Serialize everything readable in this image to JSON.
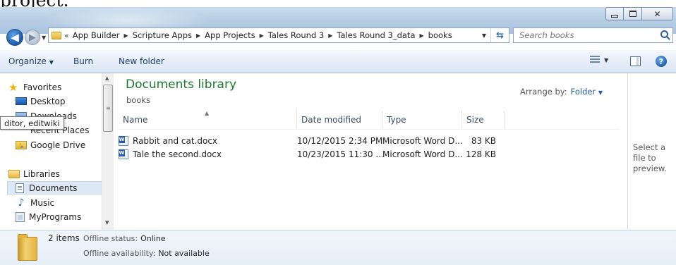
{
  "overlay_text": "project.",
  "window": {
    "minimize": "minimize",
    "maximize": "maximize",
    "close_glyph": "✕"
  },
  "address_bar": {
    "overflow_chevron": "«",
    "crumbs": [
      "App Builder",
      "Scripture Apps",
      "App Projects",
      "Tales Round 3",
      "Tales Round 3_data",
      "books"
    ]
  },
  "search": {
    "placeholder": "Search books"
  },
  "toolbar": {
    "organize": "Organize",
    "burn": "Burn",
    "new_folder": "New folder"
  },
  "nav": {
    "favorites": "Favorites",
    "desktop": "Desktop",
    "downloads": "Downloads",
    "recent_places": "Recent Places",
    "google_drive": "Google Drive",
    "libraries": "Libraries",
    "documents": "Documents",
    "music": "Music",
    "myprograms": "MyPrograms"
  },
  "tooltip": "ditor, editwiki",
  "library": {
    "title": "Documents library",
    "subtitle": "books",
    "arrange_label": "Arrange by:",
    "arrange_value": "Folder"
  },
  "columns": {
    "name": "Name",
    "date": "Date modified",
    "type": "Type",
    "size": "Size"
  },
  "files": [
    {
      "name": "Rabbit and cat.docx",
      "date": "10/12/2015 2:34 PM",
      "type": "Microsoft Word D...",
      "size": "83 KB"
    },
    {
      "name": "Tale the second.docx",
      "date": "10/23/2015 11:30 ...",
      "type": "Microsoft Word D...",
      "size": "128 KB"
    }
  ],
  "preview": {
    "text": "Select a file to preview."
  },
  "details": {
    "count": "2 items",
    "offline_status_label": "Offline status:",
    "offline_status_value": "Online",
    "offline_avail_label": "Offline availability:",
    "offline_avail_value": "Not available"
  }
}
